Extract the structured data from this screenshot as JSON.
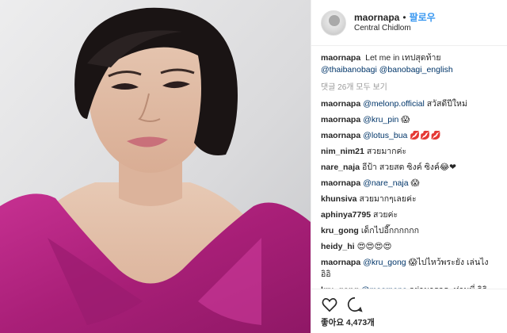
{
  "post": {
    "username": "maornapa",
    "separator": "•",
    "follow_label": "팔로우",
    "location": "Central Chidlom"
  },
  "caption": {
    "username": "maornapa",
    "text": "Let me in เทปสุดท้าย",
    "mention1": "@thaibanobagi",
    "mention2": "@banobagi_english"
  },
  "view_all_comments": "댓글 26개 모두 보기",
  "comments": [
    {
      "user": "maornapa",
      "mention": "@melonp.official",
      "text": "สวัสดีปีใหม่"
    },
    {
      "user": "maornapa",
      "mention": "@kru_pin",
      "text": "😱"
    },
    {
      "user": "maornapa",
      "mention": "@lotus_bua",
      "text": "💋💋💋"
    },
    {
      "user": "nim_nim21",
      "mention": "",
      "text": "สวยมากค่ะ"
    },
    {
      "user": "nare_naja",
      "mention": "",
      "text": "อีป้า สวยสด ซิงค์ ซิงค์😂❤"
    },
    {
      "user": "maornapa",
      "mention": "@nare_naja",
      "text": "😱"
    },
    {
      "user": "khunsiva",
      "mention": "",
      "text": "สวยมากๆเลยค่ะ"
    },
    {
      "user": "aphinya7795",
      "mention": "",
      "text": "สวยค่ะ"
    },
    {
      "user": "kru_gong",
      "mention": "",
      "text": "เด็กไปอี๊กกกกกก"
    },
    {
      "user": "heidy_hi",
      "mention": "",
      "text": "😍😍😍😍"
    },
    {
      "user": "maornapa",
      "mention": "@kru_gong",
      "text": "😱ไปไหว้พระยัง เล่นไงอิอิ"
    },
    {
      "user": "kru_gong",
      "mention": "@maornapa",
      "text": "อย่ามารถคะท่านพี่ อิอิ"
    }
  ],
  "likes_text": "좋아요 4,473개",
  "icons": {
    "like": "heart-icon",
    "comment": "comment-icon"
  },
  "colors": {
    "link": "#003569",
    "follow": "#3897f0",
    "dress": "#b0267e",
    "hair": "#1a1414"
  }
}
